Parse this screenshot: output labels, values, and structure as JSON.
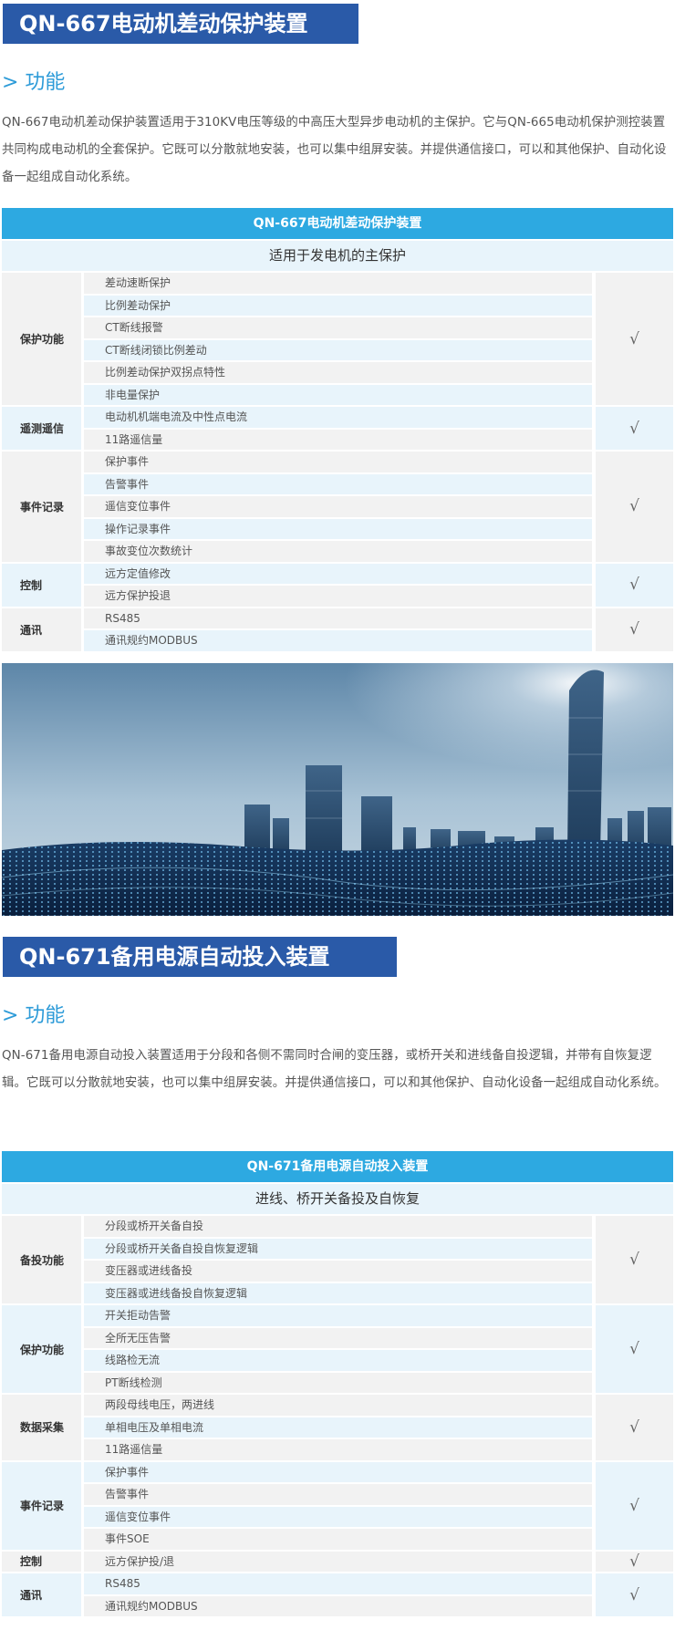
{
  "section1": {
    "title": "QN-667电动机差动保护装置",
    "function_heading": "> 功能",
    "intro": "QN-667电动机差动保护装置适用于310KV电压等级的中高压大型异步电动机的主保护。它与QN-665电动机保护测控装置共同构成电动机的全套保护。它既可以分散就地安装，也可以集中组屏安装。并提供通信接口，可以和其他保护、自动化设备一起组成自动化系统。",
    "table": {
      "header": "QN-667电动机差动保护装置",
      "subheader": "适用于发电机的主保护",
      "groups": [
        {
          "category": "保护功能",
          "items": [
            "差动速断保护",
            "比例差动保护",
            "CT断线报警",
            "CT断线闭锁比例差动",
            "比例差动保护双拐点特性",
            "非电量保护"
          ],
          "check": "√"
        },
        {
          "category": "遥测遥信",
          "items": [
            "电动机机端电流及中性点电流",
            "11路遥信量"
          ],
          "check": "√"
        },
        {
          "category": "事件记录",
          "items": [
            "保护事件",
            "告警事件",
            "遥信变位事件",
            "操作记录事件",
            "事故变位次数统计"
          ],
          "check": "√"
        },
        {
          "category": "控制",
          "items": [
            "远方定值修改",
            "远方保护投退"
          ],
          "check": "√"
        },
        {
          "category": "通讯",
          "items": [
            "RS485",
            "通讯规约MODBUS"
          ],
          "check": "√"
        }
      ]
    }
  },
  "section2": {
    "title": "QN-671备用电源自动投入装置",
    "function_heading": "> 功能",
    "intro": "QN-671备用电源自动投入装置适用于分段和各侧不需同时合闸的变压器，或桥开关和进线备自投逻辑，并带有自恢复逻辑。它既可以分散就地安装，也可以集中组屏安装。并提供通信接口，可以和其他保护、自动化设备一起组成自动化系统。",
    "table": {
      "header": "QN-671备用电源自动投入装置",
      "subheader": "进线、桥开关备投及自恢复",
      "groups": [
        {
          "category": "备投功能",
          "items": [
            "分段或桥开关备自投",
            "分段或桥开关备自投自恢复逻辑",
            "变压器或进线备投",
            "变压器或进线备投自恢复逻辑"
          ],
          "check": "√"
        },
        {
          "category": "保护功能",
          "items": [
            "开关拒动告警",
            "全所无压告警",
            "线路检无流",
            "PT断线检测"
          ],
          "check": "√"
        },
        {
          "category": "数据采集",
          "items": [
            "两段母线电压，两进线",
            "单相电压及单相电流",
            "11路遥信量"
          ],
          "check": "√"
        },
        {
          "category": "事件记录",
          "items": [
            "保护事件",
            "告警事件",
            "遥信变位事件",
            "事件SOE"
          ],
          "check": "√"
        },
        {
          "category": "控制",
          "items": [
            "远方保护投/退"
          ],
          "check": "√"
        },
        {
          "category": "通讯",
          "items": [
            "RS485",
            "通讯规约MODBUS"
          ],
          "check": "√"
        }
      ]
    }
  },
  "colors": {
    "banner": "#2a5aa8",
    "heading_accent": "#2d9bd8",
    "table_header": "#2da9e1",
    "row_light_blue": "#e8f4fb",
    "row_light_gray": "#f2f2f2"
  }
}
